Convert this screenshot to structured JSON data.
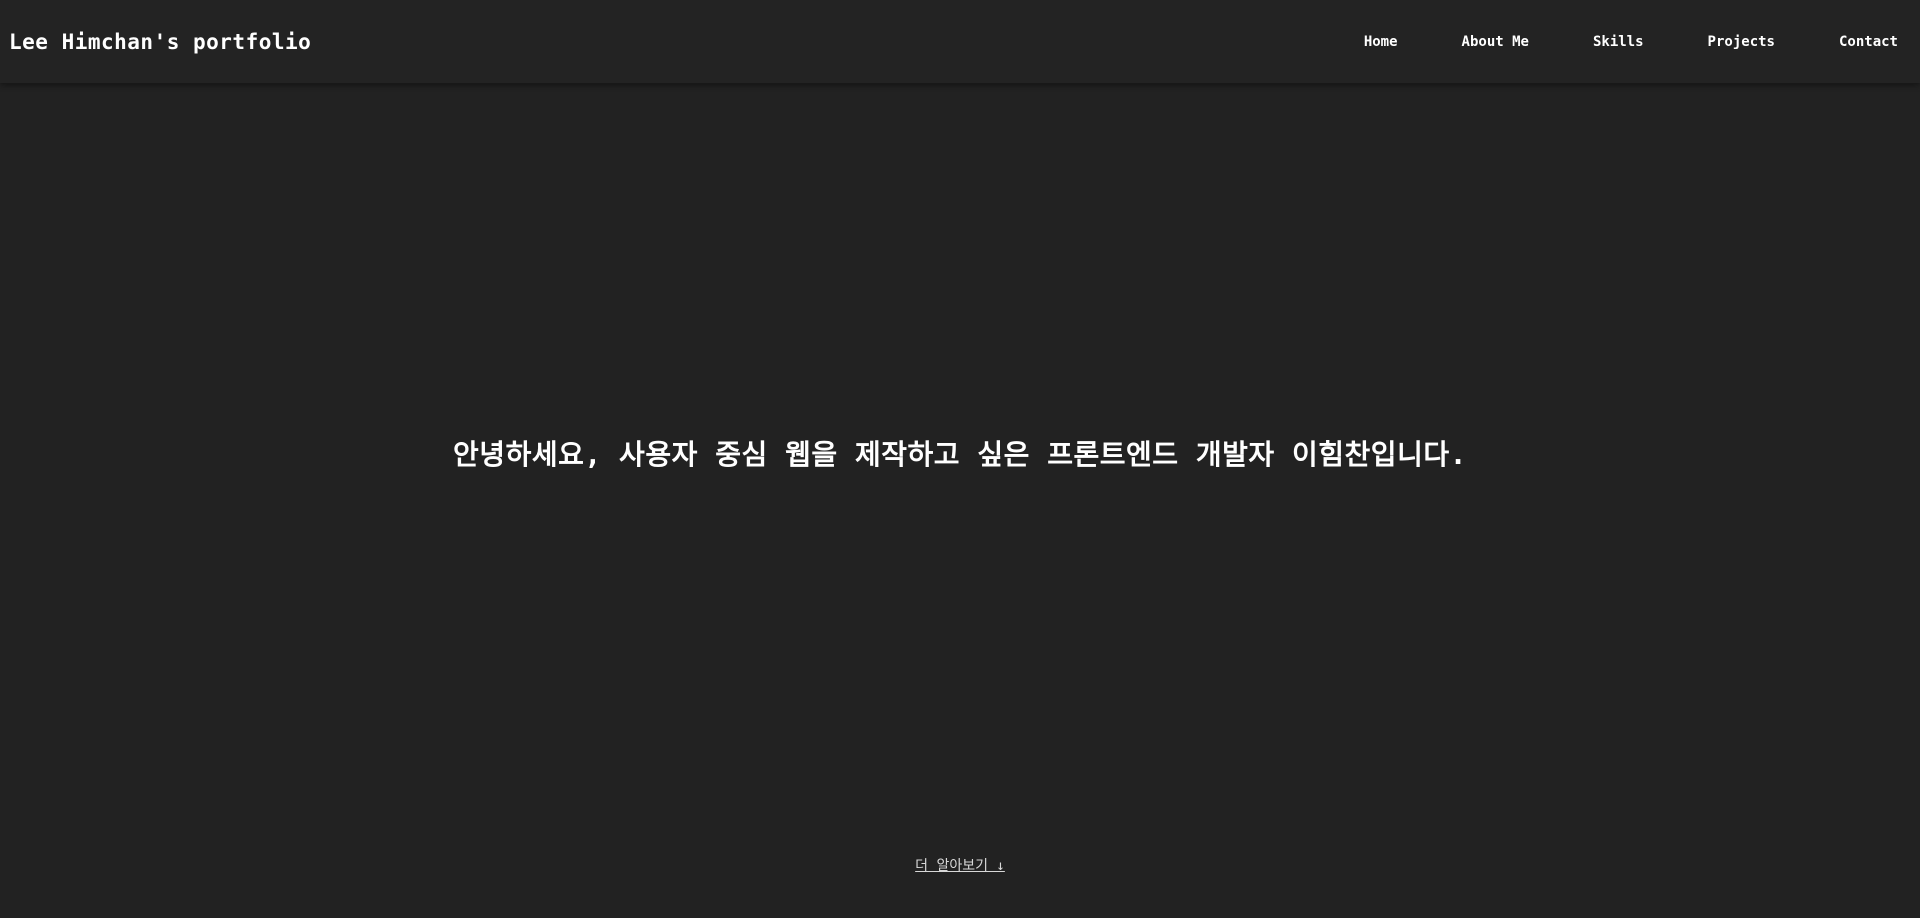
{
  "nav": {
    "brand": "Lee Himchan's portfolio",
    "links": [
      {
        "label": "Home"
      },
      {
        "label": "About Me"
      },
      {
        "label": "Skills"
      },
      {
        "label": "Projects"
      },
      {
        "label": "Contact"
      }
    ]
  },
  "hero": {
    "text": "안녕하세요, 사용자 중심 웹을 제작하고 싶은 프론트엔드 개발자 이힘찬입니다.",
    "more_link": "더 알아보기 ↓"
  },
  "colors": {
    "background": "#222222",
    "navbar": "#232323",
    "text": "#ffffff"
  }
}
